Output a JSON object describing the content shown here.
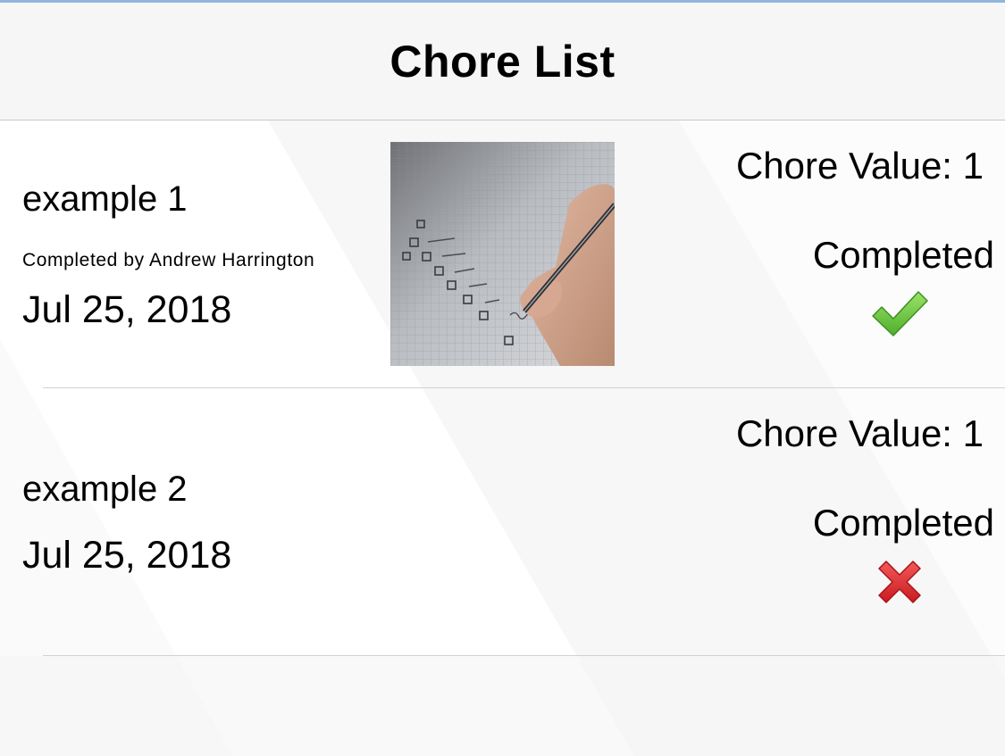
{
  "header": {
    "title": "Chore List"
  },
  "chores": [
    {
      "name": "example 1",
      "completed_by": "Completed by Andrew Harrington",
      "date": "Jul 25, 2018",
      "value": "Chore Value: 1",
      "status_label": "Completed",
      "status": "done",
      "status_icon": "checkmark-icon",
      "has_photo": true
    },
    {
      "name": "example 2",
      "date": "Jul 25, 2018",
      "value": "Chore Value: 1",
      "status_label": "Completed",
      "status": "not-done",
      "status_icon": "cross-icon",
      "has_photo": false
    }
  ],
  "colors": {
    "nav_background": "#f6f6f6",
    "top_accent": "#8fb6df",
    "check_green": "#6cc43a",
    "cross_red": "#e0262a",
    "divider": "#d2d2d2"
  }
}
